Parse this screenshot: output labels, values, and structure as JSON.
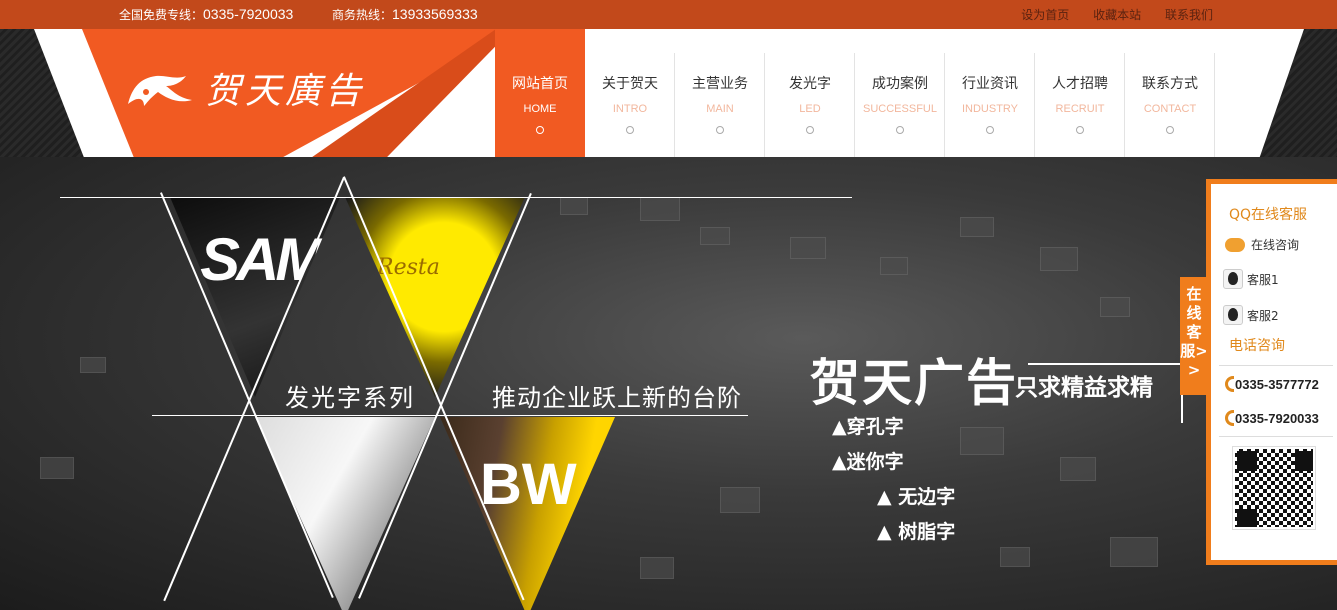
{
  "topbar": {
    "hotline_label": "全国免费专线：",
    "hotline_number": "0335-7920033",
    "business_label": "商务热线：",
    "business_number": "13933569333",
    "links": [
      "设为首页",
      "收藏本站",
      "联系我们"
    ]
  },
  "logo": {
    "text": "贺天廣告"
  },
  "nav": [
    {
      "cn": "网站首页",
      "en": "HOME",
      "active": true
    },
    {
      "cn": "关于贺天",
      "en": "INTRO"
    },
    {
      "cn": "主营业务",
      "en": "MAIN"
    },
    {
      "cn": "发光字",
      "en": "LED"
    },
    {
      "cn": "成功案例",
      "en": "SUCCESSFUL"
    },
    {
      "cn": "行业资讯",
      "en": "INDUSTRY"
    },
    {
      "cn": "人才招聘",
      "en": "RECRUIT"
    },
    {
      "cn": "联系方式",
      "en": "CONTACT"
    }
  ],
  "banner": {
    "slogan_left": "发光字系列",
    "slogan_right": "推动企业跃上新的台阶",
    "brand": "贺天广告",
    "brand_sub": "只求精益求精",
    "features": [
      "▲穿孔字",
      "▲迷你字",
      "▲ 无边字",
      "▲ 树脂字"
    ],
    "tri_texts": [
      "SAM",
      "Resta",
      "BW"
    ]
  },
  "service": {
    "tab_label": "在线客服>>",
    "qq_title": "QQ在线客服",
    "consult": "在线咨询",
    "agent1": "客服1",
    "agent2": "客服2",
    "phone_title": "电话咨询",
    "phone1": "0335-3577772",
    "phone2": "0335-7920033"
  }
}
